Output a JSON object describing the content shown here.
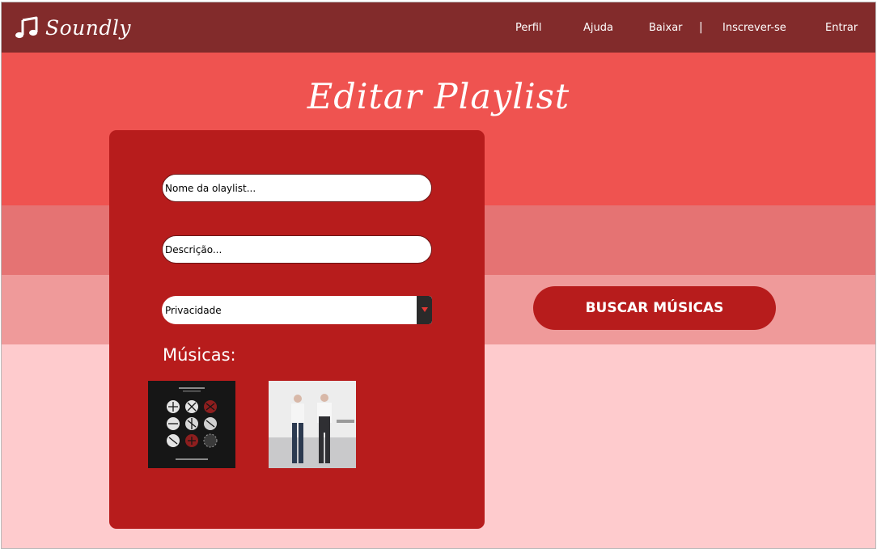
{
  "brand": {
    "name": "Soundly",
    "icon": "music-note-icon"
  },
  "nav": {
    "items": [
      "Perfil",
      "Ajuda",
      "Baixar",
      "Inscrever-se",
      "Entrar"
    ],
    "separator": "|"
  },
  "page": {
    "title": "Editar Playlist"
  },
  "form": {
    "name_placeholder": "Nome da olaylist...",
    "name_value": "",
    "description_placeholder": "Descrição...",
    "description_value": "",
    "privacy_selected": "Privacidade",
    "songs_label": "Músicas:",
    "albums": [
      {
        "name": "album-cover-dark-circles"
      },
      {
        "name": "album-cover-two-men"
      }
    ]
  },
  "search_button_label": "BUSCAR MÚSICAS",
  "colors": {
    "navbar": "#822b2b",
    "band_1": "#ef5350",
    "band_2": "#e57373",
    "band_3": "#ef9a9a",
    "band_4": "#fecbcd",
    "card": "#b71c1c",
    "button": "#b71c1c"
  }
}
